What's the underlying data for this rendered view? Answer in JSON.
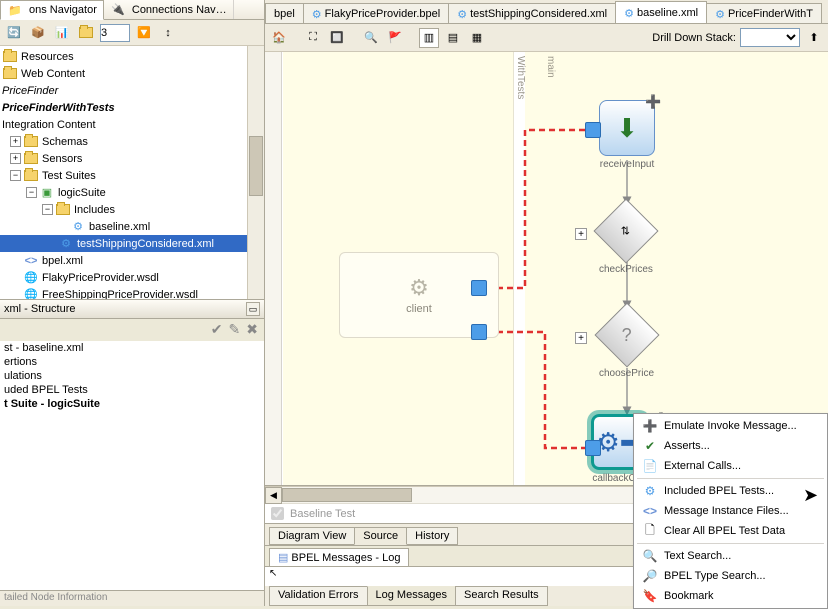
{
  "nav": {
    "tab_app": "ons Navigator",
    "tab_conn": "Connections Nav…",
    "spinner_value": "3"
  },
  "tree": {
    "resources": "Resources",
    "web_content": "Web Content",
    "pricefinder": "PriceFinder",
    "pricefinder_tests": "PriceFinderWithTests",
    "integration": "Integration Content",
    "schemas": "Schemas",
    "sensors": "Sensors",
    "test_suites": "Test Suites",
    "logic_suite": "logicSuite",
    "includes": "Includes",
    "baseline": "baseline.xml",
    "test_shipping": "testShippingConsidered.xml",
    "bpel_xml": "bpel.xml",
    "flaky_wsdl": "FlakyPriceProvider.wsdl",
    "free_wsdl": "FreeShippingPriceProvider.wsdl"
  },
  "structure": {
    "header": "xml - Structure",
    "row1": "st - baseline.xml",
    "row2": "ertions",
    "row3": "ulations",
    "row4": "uded BPEL Tests",
    "row5": "t Suite - logicSuite",
    "footer": "tailed Node Information"
  },
  "editor_tabs": {
    "t1": "bpel",
    "t2": "FlakyPriceProvider.bpel",
    "t3": "testShippingConsidered.xml",
    "t4": "baseline.xml",
    "t5": "PriceFinderWithT"
  },
  "diagram": {
    "drill_label": "Drill Down Stack:",
    "lane_with_tests": "WithTests",
    "lane_main": "main",
    "client": "client",
    "receive_input": "receiveInput",
    "check_prices": "checkPrices",
    "choose_price": "choosePrice",
    "callback_client": "callbackClie",
    "baseline_test": "Baseline Test"
  },
  "view_tabs": {
    "diagram": "Diagram View",
    "source": "Source",
    "history": "History"
  },
  "log": {
    "title": "BPEL Messages - Log"
  },
  "result_tabs": {
    "validation": "Validation Errors",
    "log_messages": "Log Messages",
    "search": "Search Results"
  },
  "ctx": {
    "emulate": "Emulate Invoke Message...",
    "asserts": "Asserts...",
    "external": "External Calls...",
    "included": "Included BPEL Tests...",
    "msg_instance": "Message Instance Files...",
    "clear_all": "Clear All BPEL Test Data",
    "text_search": "Text Search...",
    "type_search": "BPEL Type Search...",
    "bookmark": "Bookmark"
  }
}
